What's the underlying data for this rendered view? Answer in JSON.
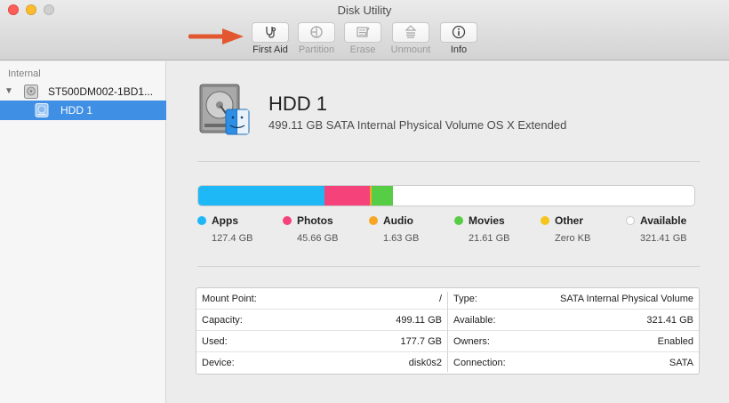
{
  "window": {
    "title": "Disk Utility"
  },
  "toolbar": {
    "items": [
      {
        "label": "First Aid",
        "icon": "stethoscope-icon",
        "enabled": true
      },
      {
        "label": "Partition",
        "icon": "partition-pie-icon",
        "enabled": false
      },
      {
        "label": "Erase",
        "icon": "erase-icon",
        "enabled": false
      },
      {
        "label": "Unmount",
        "icon": "unmount-icon",
        "enabled": false
      },
      {
        "label": "Info",
        "icon": "info-icon",
        "enabled": true
      }
    ]
  },
  "sidebar": {
    "section": "Internal",
    "disk": {
      "label": "ST500DM002-1BD1...",
      "icon": "hard-disk-icon",
      "expanded": true
    },
    "volume": {
      "label": "HDD 1",
      "icon": "volume-icon",
      "selected": true
    }
  },
  "volume": {
    "name": "HDD 1",
    "description": "499.11 GB SATA Internal Physical Volume OS X Extended"
  },
  "usage": {
    "total_gb": 499.11,
    "categories": [
      {
        "name": "Apps",
        "size": "127.4 GB",
        "gb": 127.4,
        "color": "#1fb8f6"
      },
      {
        "name": "Photos",
        "size": "45.66 GB",
        "gb": 45.66,
        "color": "#f5427a"
      },
      {
        "name": "Audio",
        "size": "1.63 GB",
        "gb": 1.63,
        "color": "#f6a623"
      },
      {
        "name": "Movies",
        "size": "21.61 GB",
        "gb": 21.61,
        "color": "#57cd45"
      },
      {
        "name": "Other",
        "size": "Zero KB",
        "gb": 0,
        "color": "#f6c51c"
      },
      {
        "name": "Available",
        "size": "321.41 GB",
        "gb": 321.41,
        "color": "#ffffff"
      }
    ]
  },
  "info": {
    "left": [
      {
        "key": "Mount Point:",
        "value": "/"
      },
      {
        "key": "Capacity:",
        "value": "499.11 GB"
      },
      {
        "key": "Used:",
        "value": "177.7 GB"
      },
      {
        "key": "Device:",
        "value": "disk0s2"
      }
    ],
    "right": [
      {
        "key": "Type:",
        "value": "SATA Internal Physical Volume"
      },
      {
        "key": "Available:",
        "value": "321.41 GB"
      },
      {
        "key": "Owners:",
        "value": "Enabled"
      },
      {
        "key": "Connection:",
        "value": "SATA"
      }
    ]
  }
}
